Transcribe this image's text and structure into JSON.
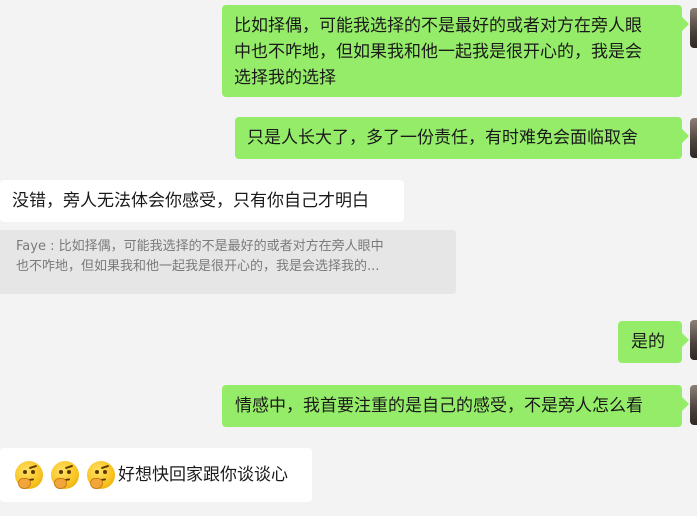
{
  "messages": [
    {
      "side": "out",
      "lines": [
        "比如择偶，可能我选择的不是最好的或者对方在旁人眼",
        "中也不咋地，但如果我和他一起我是很开心的，我是会",
        "选择我的选择"
      ]
    },
    {
      "side": "out",
      "text": "只是人长大了，多了一份责任，有时难免会面临取舍"
    },
    {
      "side": "in",
      "text": "没错，旁人无法体会你感受，只有你自己才明白"
    },
    {
      "side": "quote",
      "lines": [
        "Faye : 比如择偶，可能我选择的不是最好的或者对方在旁人眼中",
        "也不咋地，但如果我和他一起我是很开心的，我是会选择我的..."
      ]
    },
    {
      "side": "out",
      "text": "是的"
    },
    {
      "side": "out",
      "text": "情感中，我首要注重的是自己的感受，不是旁人怎么看"
    },
    {
      "side": "in",
      "emojis": [
        "thinking-face",
        "thinking-face",
        "thinking-face"
      ],
      "text": "好想快回家跟你谈谈心"
    }
  ]
}
